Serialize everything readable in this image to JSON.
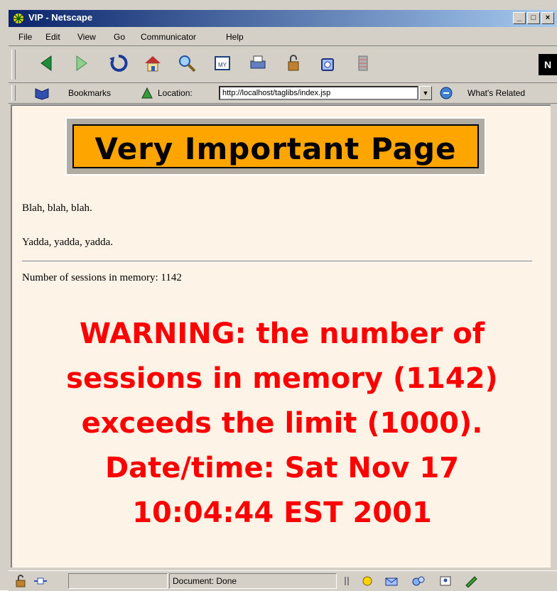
{
  "window": {
    "title": "VIP - Netscape"
  },
  "menu": [
    "File",
    "Edit",
    "View",
    "Go",
    "Communicator",
    "Help"
  ],
  "toolbar": {
    "icons": [
      "back-icon",
      "forward-icon",
      "reload-icon",
      "home-icon",
      "search-icon",
      "my-netscape-icon",
      "print-icon",
      "security-icon",
      "shop-icon",
      "stop-icon"
    ],
    "brand": "N"
  },
  "location_bar": {
    "bookmarks_label": "Bookmarks",
    "location_label": "Location:",
    "url": "http://localhost/taglibs/index.jsp",
    "whats_related_label": "What's Related"
  },
  "page": {
    "banner_title": "Very Important Page",
    "paragraphs": [
      "Blah, blah, blah.",
      "Yadda, yadda, yadda."
    ],
    "session_text": "Number of sessions in memory: 1142",
    "warning_lines": [
      "WARNING: the number of",
      "sessions in memory (1142)",
      "exceeds the limit (1000).",
      "Date/time: Sat Nov 17",
      "10:04:44 EST 2001"
    ]
  },
  "status": {
    "text": "Document: Done"
  },
  "colors": {
    "banner_bg": "#ffa500",
    "warning": "#ff0000",
    "page_bg": "#fdf3e6",
    "titlebar": "#0a246a"
  }
}
